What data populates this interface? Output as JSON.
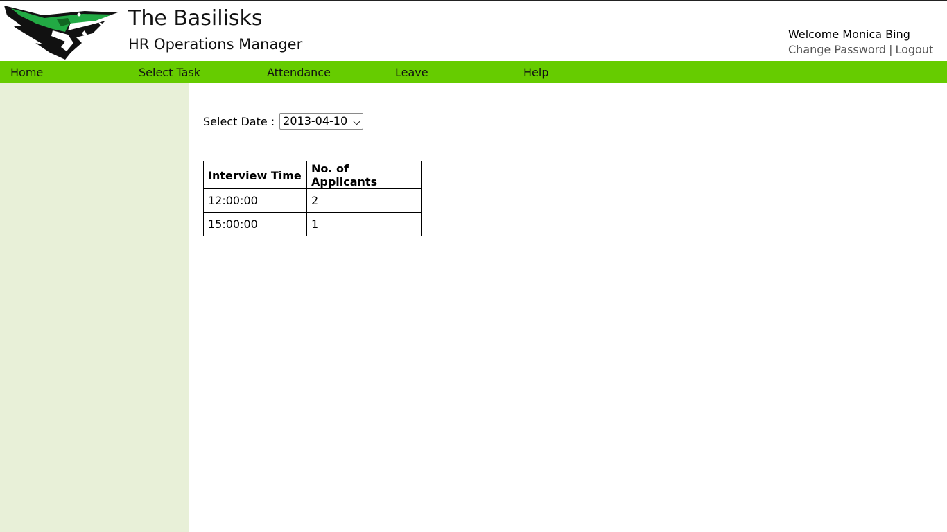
{
  "header": {
    "title": "The Basilisks",
    "subtitle": "HR Operations Manager",
    "logo_icon": "basilisk-snake-logo",
    "welcome": "Welcome Monica Bing",
    "change_password": "Change Password",
    "separator": "|",
    "logout": "Logout"
  },
  "nav": {
    "items": [
      "Home",
      "Select Task",
      "Attendance",
      "Leave",
      "Help"
    ]
  },
  "colors": {
    "nav_bg": "#66cc00",
    "sidebar_bg": "#e8f0d8",
    "logo_green": "#22aa44"
  },
  "main": {
    "date_label": "Select Date :",
    "date_value": "2013-04-10",
    "table": {
      "headers": [
        "Interview Time",
        "No. of Applicants"
      ],
      "rows": [
        [
          "12:00:00",
          "2"
        ],
        [
          "15:00:00",
          "1"
        ]
      ]
    }
  }
}
